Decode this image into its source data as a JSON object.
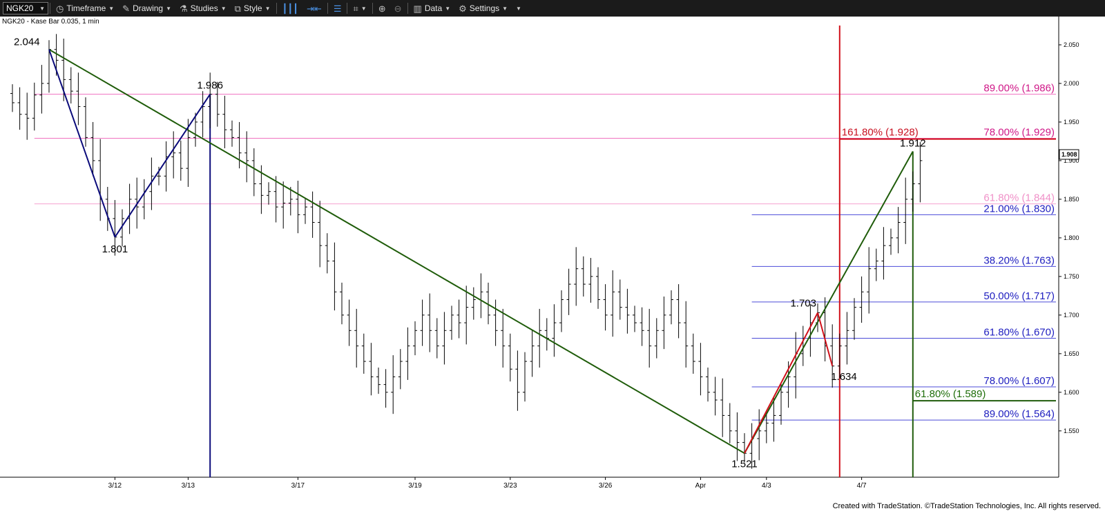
{
  "toolbar": {
    "symbol": "NGK20",
    "timeframe": "Timeframe",
    "drawing": "Drawing",
    "studies": "Studies",
    "style": "Style",
    "data": "Data",
    "settings": "Settings"
  },
  "subtitle": "NGK20 - Kase Bar 0.035, 1 min",
  "footer": "Created with TradeStation. ©TradeStation Technologies, Inc. All rights reserved.",
  "colors": {
    "green": "#1f5c0a",
    "navy": "#0a0a7a",
    "red": "#d0101a",
    "pink": "#f070c0",
    "lightpink": "#f4a0cf",
    "blue": "#4a4ad8",
    "pinkText": "#d01888",
    "lightpinkText": "#f090c8",
    "blueText": "#2020c0",
    "redText": "#c81020",
    "greenText": "#1f6e0a"
  },
  "chart_data": {
    "type": "bar",
    "price_bar_type": "OHLC",
    "ylim": [
      1.49,
      2.075
    ],
    "y_ticks": [
      "1.550",
      "1.600",
      "1.650",
      "1.700",
      "1.750",
      "1.800",
      "1.850",
      "1.900",
      "1.950",
      "2.000",
      "2.050"
    ],
    "current_price": "1.908",
    "x_ticks": [
      {
        "label": "3/12",
        "bar": 14
      },
      {
        "label": "3/13",
        "bar": 24
      },
      {
        "label": "3/17",
        "bar": 39
      },
      {
        "label": "3/19",
        "bar": 55
      },
      {
        "label": "3/23",
        "bar": 68
      },
      {
        "label": "3/26",
        "bar": 81
      },
      {
        "label": "Apr",
        "bar": 94
      },
      {
        "label": "4/3",
        "bar": 103
      },
      {
        "label": "4/7",
        "bar": 116
      }
    ],
    "bar_count": 124,
    "closes": [
      1.975,
      1.96,
      1.955,
      1.985,
      2.0,
      2.044,
      2.03,
      2.005,
      1.99,
      1.97,
      1.93,
      1.9,
      1.85,
      1.825,
      1.801,
      1.825,
      1.85,
      1.84,
      1.86,
      1.88,
      1.88,
      1.905,
      1.91,
      1.89,
      1.93,
      1.95,
      1.97,
      1.986,
      1.96,
      1.94,
      1.93,
      1.91,
      1.9,
      1.87,
      1.855,
      1.86,
      1.84,
      1.845,
      1.85,
      1.83,
      1.84,
      1.82,
      1.79,
      1.77,
      1.73,
      1.7,
      1.68,
      1.66,
      1.64,
      1.62,
      1.61,
      1.6,
      1.62,
      1.64,
      1.66,
      1.68,
      1.7,
      1.68,
      1.66,
      1.68,
      1.7,
      1.69,
      1.71,
      1.72,
      1.73,
      1.7,
      1.68,
      1.66,
      1.63,
      1.6,
      1.64,
      1.66,
      1.68,
      1.67,
      1.69,
      1.72,
      1.74,
      1.76,
      1.74,
      1.75,
      1.72,
      1.7,
      1.73,
      1.71,
      1.7,
      1.69,
      1.68,
      1.66,
      1.68,
      1.7,
      1.72,
      1.69,
      1.66,
      1.64,
      1.62,
      1.6,
      1.59,
      1.57,
      1.55,
      1.535,
      1.521,
      1.54,
      1.55,
      1.56,
      1.57,
      1.6,
      1.62,
      1.65,
      1.67,
      1.69,
      1.703,
      1.66,
      1.634,
      1.66,
      1.68,
      1.71,
      1.73,
      1.76,
      1.77,
      1.79,
      1.8,
      1.82,
      1.85,
      1.87,
      1.9
    ],
    "swing_points": [
      {
        "label": "2.044",
        "bar": 5,
        "value": 2.044
      },
      {
        "label": "1.801",
        "bar": 14,
        "value": 1.801
      },
      {
        "label": "1.986",
        "bar": 27,
        "value": 1.986
      },
      {
        "label": "1.521",
        "bar": 100,
        "value": 1.521
      },
      {
        "label": "1.703",
        "bar": 110,
        "value": 1.703
      },
      {
        "label": "1.634",
        "bar": 112,
        "value": 1.634
      },
      {
        "label": "1.912",
        "bar": 123,
        "value": 1.912
      }
    ],
    "fib_levels": [
      {
        "label": "89.00% (1.986)",
        "value": 1.986,
        "kind": "pink",
        "from_bar": 3
      },
      {
        "label": "78.00% (1.929)",
        "value": 1.929,
        "kind": "pink",
        "from_bar": 3
      },
      {
        "label": "61.80% (1.844)",
        "value": 1.844,
        "kind": "lightpink",
        "from_bar": 3
      },
      {
        "label": "21.00% (1.830)",
        "value": 1.83,
        "kind": "blue",
        "from_bar": 101
      },
      {
        "label": "38.20% (1.763)",
        "value": 1.763,
        "kind": "blue",
        "from_bar": 101
      },
      {
        "label": "50.00% (1.717)",
        "value": 1.717,
        "kind": "blue",
        "from_bar": 101
      },
      {
        "label": "61.80% (1.670)",
        "value": 1.67,
        "kind": "blue",
        "from_bar": 101
      },
      {
        "label": "78.00% (1.607)",
        "value": 1.607,
        "kind": "blue",
        "from_bar": 101
      },
      {
        "label": "89.00% (1.564)",
        "value": 1.564,
        "kind": "blue",
        "from_bar": 101
      }
    ],
    "projections": [
      {
        "label": "161.80% (1.928)",
        "value": 1.928,
        "kind": "red",
        "from_bar": 113
      },
      {
        "label": "61.80% (1.589)",
        "value": 1.589,
        "kind": "green",
        "from_bar": 123
      }
    ],
    "trend_lines": [
      {
        "kind": "green",
        "from": {
          "bar": 5,
          "value": 2.044
        },
        "to": {
          "bar": 100,
          "value": 1.521
        }
      },
      {
        "kind": "green",
        "from": {
          "bar": 100,
          "value": 1.521
        },
        "to": {
          "bar": 123,
          "value": 1.912
        }
      },
      {
        "kind": "navy",
        "from": {
          "bar": 5,
          "value": 2.044
        },
        "to": {
          "bar": 14,
          "value": 1.801
        }
      },
      {
        "kind": "navy",
        "from": {
          "bar": 14,
          "value": 1.801
        },
        "to": {
          "bar": 27,
          "value": 1.986
        }
      },
      {
        "kind": "red",
        "from": {
          "bar": 100,
          "value": 1.521
        },
        "to": {
          "bar": 110,
          "value": 1.703
        }
      },
      {
        "kind": "red",
        "from": {
          "bar": 110,
          "value": 1.703
        },
        "to": {
          "bar": 112,
          "value": 1.634
        }
      }
    ],
    "vertical_lines": [
      {
        "kind": "navy",
        "bar": 27,
        "from_value": 1.986
      },
      {
        "kind": "red",
        "bar": 113,
        "from_value": 2.075
      },
      {
        "kind": "green",
        "bar": 123,
        "from_value": 1.912
      }
    ]
  }
}
